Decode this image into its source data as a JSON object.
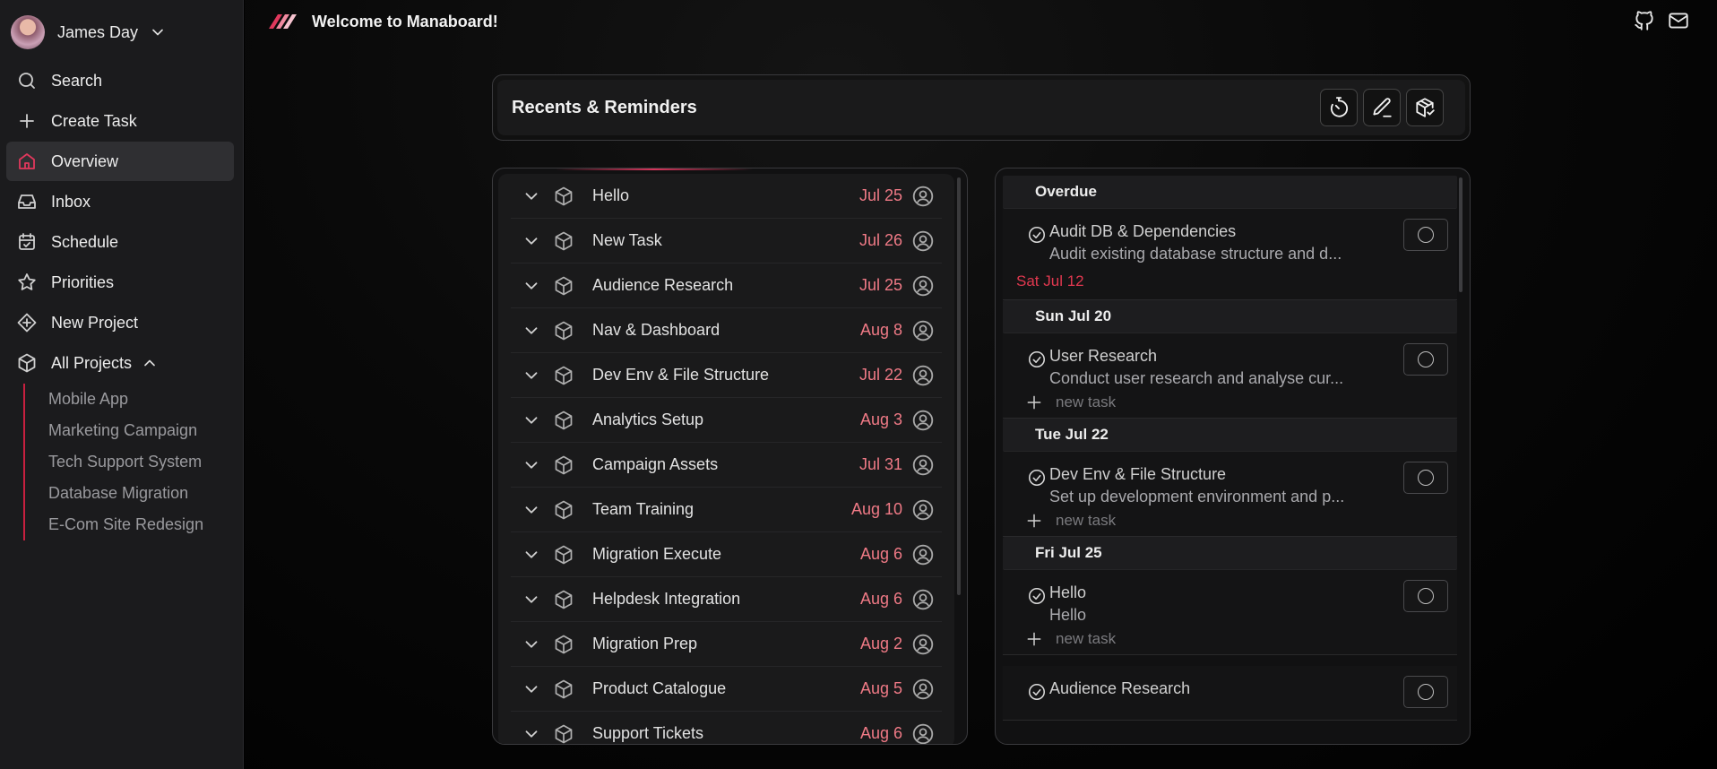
{
  "user": {
    "name": "James Day"
  },
  "nav": [
    {
      "label": "Search",
      "icon": "search-icon"
    },
    {
      "label": "Create Task",
      "icon": "plus-icon"
    },
    {
      "label": "Overview",
      "icon": "home-icon",
      "active": true
    },
    {
      "label": "Inbox",
      "icon": "inbox-icon"
    },
    {
      "label": "Schedule",
      "icon": "calendar-check-icon"
    },
    {
      "label": "Priorities",
      "icon": "star-icon"
    },
    {
      "label": "New Project",
      "icon": "diamond-plus-icon"
    },
    {
      "label": "All Projects",
      "icon": "cube-icon",
      "expanded": true
    }
  ],
  "projects": [
    "Mobile App",
    "Marketing Campaign",
    "Tech Support System",
    "Database Migration",
    "E-Com Site Redesign"
  ],
  "topbar": {
    "welcome": "Welcome to Manaboard!",
    "icons": [
      "github-icon",
      "mail-icon"
    ]
  },
  "header": {
    "title": "Recents & Reminders",
    "actions": [
      "timer-icon",
      "pencil-icon",
      "package-check-icon"
    ]
  },
  "colors": {
    "accent": "#e0385c",
    "due": "#f07a86",
    "overdue": "#e0384f"
  },
  "recents": [
    {
      "name": "Hello",
      "date": "Jul 25"
    },
    {
      "name": "New Task",
      "date": "Jul 26"
    },
    {
      "name": "Audience Research",
      "date": "Jul 25"
    },
    {
      "name": "Nav & Dashboard",
      "date": "Aug 8"
    },
    {
      "name": "Dev Env & File Structure",
      "date": "Jul 22"
    },
    {
      "name": "Analytics Setup",
      "date": "Aug 3"
    },
    {
      "name": "Campaign Assets",
      "date": "Jul 31"
    },
    {
      "name": "Team Training",
      "date": "Aug 10"
    },
    {
      "name": "Migration Execute",
      "date": "Aug 6"
    },
    {
      "name": "Helpdesk Integration",
      "date": "Aug 6"
    },
    {
      "name": "Migration Prep",
      "date": "Aug 2"
    },
    {
      "name": "Product Catalogue",
      "date": "Aug 5"
    },
    {
      "name": "Support Tickets",
      "date": "Aug 6"
    }
  ],
  "reminders": {
    "overdue": {
      "heading": "Overdue",
      "task": {
        "title": "Audit DB & Dependencies",
        "desc": "Audit existing database structure and d..."
      },
      "due": "Sat Jul 12"
    },
    "days": [
      {
        "heading": "Sun Jul 20",
        "task": {
          "title": "User Research",
          "desc": "Conduct user research and analyse cur..."
        },
        "new_task": "new task"
      },
      {
        "heading": "Tue Jul 22",
        "task": {
          "title": "Dev Env & File Structure",
          "desc": "Set up development environment and p..."
        },
        "new_task": "new task"
      },
      {
        "heading": "Fri Jul 25",
        "task": {
          "title": "Hello",
          "desc": "Hello"
        },
        "new_task": "new task"
      }
    ],
    "partial": {
      "title": "Audience Research"
    }
  }
}
